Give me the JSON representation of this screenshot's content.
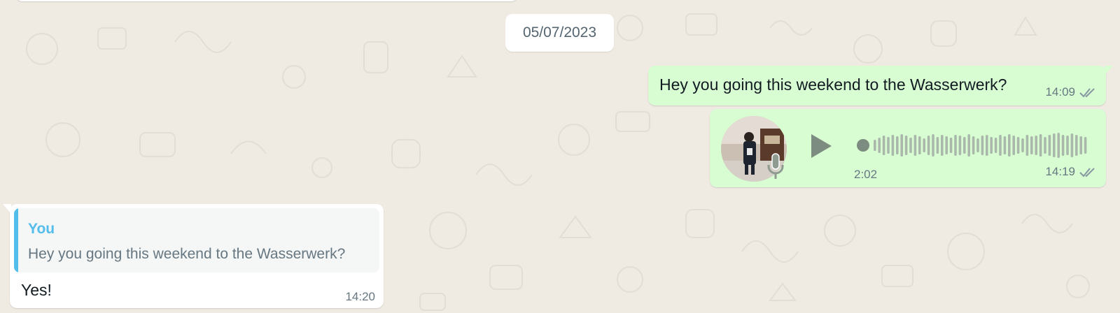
{
  "date_separator": "05/07/2023",
  "messages": [
    {
      "direction": "outgoing",
      "type": "text",
      "text": "Hey you going this weekend to the Wasserwerk?",
      "time": "14:09",
      "status_icon": "double-check-icon"
    },
    {
      "direction": "outgoing",
      "type": "voice",
      "duration": "2:02",
      "time": "14:19",
      "playback_progress": 0,
      "status_icon": "double-check-icon"
    },
    {
      "direction": "incoming",
      "type": "reply",
      "quoted_author": "You",
      "quoted_text": "Hey you going this weekend to the Wasserwerk?",
      "text": "Yes!",
      "time": "14:20"
    }
  ],
  "colors": {
    "wallpaper": "#efeae2",
    "outgoing_bubble": "#d9fdd3",
    "incoming_bubble": "#ffffff",
    "quote_accent": "#53bdeb",
    "meta_text": "#667781"
  }
}
